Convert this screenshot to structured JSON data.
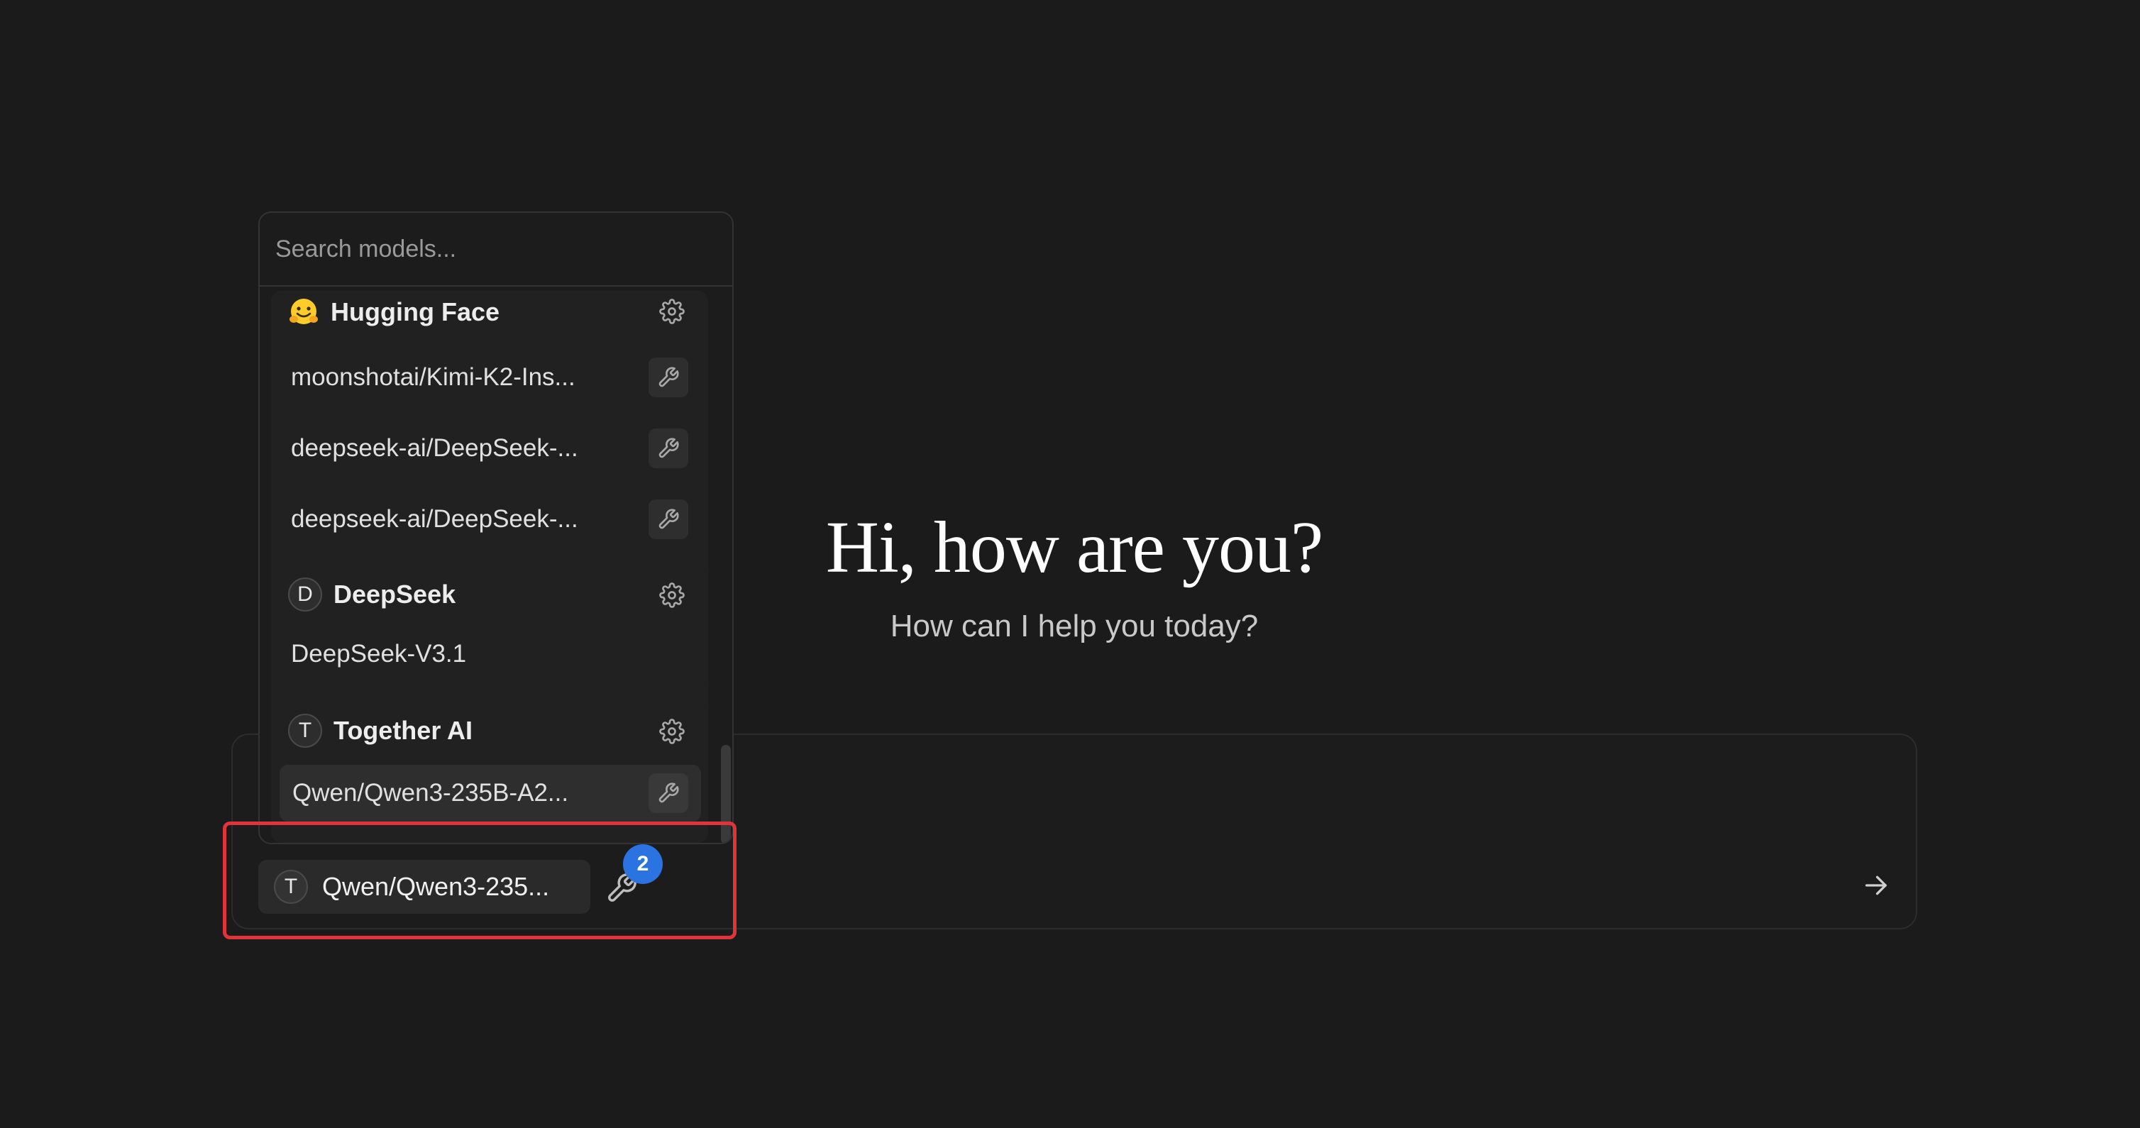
{
  "greeting": {
    "title": "Hi, how are you?",
    "subtitle": "How can I help you today?"
  },
  "model_picker": {
    "search_placeholder": "Search models...",
    "groups": [
      {
        "name": "Hugging Face",
        "icon": "hugging-face-emoji-icon",
        "models": [
          {
            "label": "moonshotai/Kimi-K2-Ins...",
            "tools": true
          },
          {
            "label": "deepseek-ai/DeepSeek-...",
            "tools": true
          },
          {
            "label": "deepseek-ai/DeepSeek-...",
            "tools": true
          }
        ]
      },
      {
        "name": "DeepSeek",
        "avatar_letter": "D",
        "models": [
          {
            "label": "DeepSeek-V3.1",
            "tools": false
          }
        ]
      },
      {
        "name": "Together AI",
        "avatar_letter": "T",
        "models": [
          {
            "label": "Qwen/Qwen3-235B-A2...",
            "tools": true,
            "selected": true
          }
        ]
      }
    ]
  },
  "composer": {
    "selected_model": {
      "avatar_letter": "T",
      "label": "Qwen/Qwen3-235..."
    },
    "tools_count": "2"
  },
  "colors": {
    "background": "#1b1b1b",
    "badge": "#2a73e0",
    "highlight": "#e0333a"
  }
}
